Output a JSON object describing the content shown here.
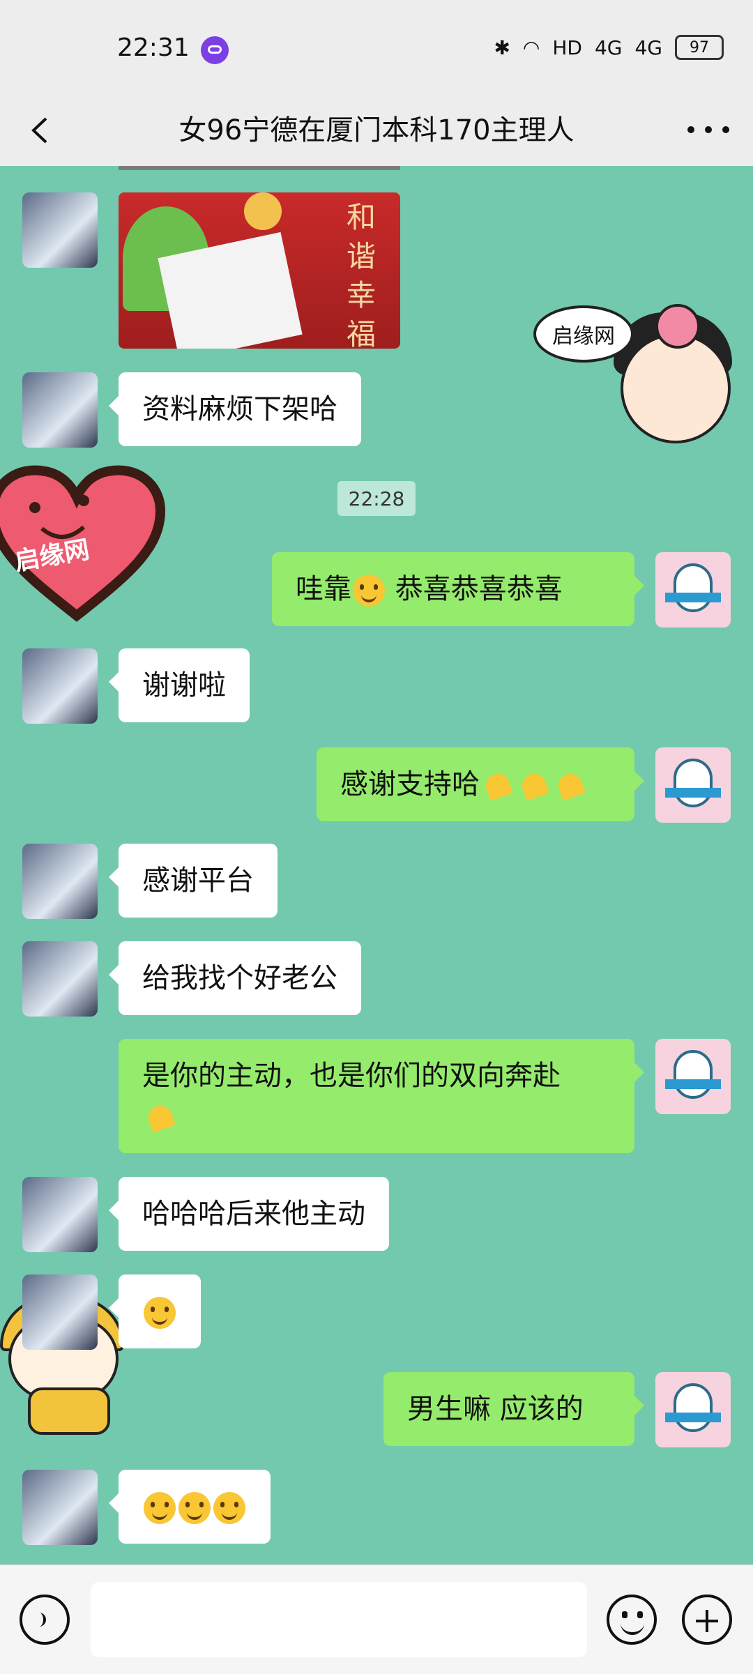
{
  "status": {
    "time": "22:31",
    "battery": "97",
    "network_a": "4G",
    "network_b": "4G",
    "hd": "HD"
  },
  "header": {
    "title": "女96宁德在厦门本科170主理人"
  },
  "chat": {
    "timestamp": "22:28",
    "sticker_girl_text": "启缘网",
    "heart_text": "启缘网",
    "photo_chars": "和谐幸福",
    "messages": [
      {
        "side": "left",
        "text": "资料麻烦下架哈"
      },
      {
        "side": "right",
        "text": "哇靠",
        "text2": "恭喜恭喜恭喜",
        "emoji": "666-emoji"
      },
      {
        "side": "left",
        "text": "谢谢啦"
      },
      {
        "side": "right",
        "text": "感谢支持哈",
        "emoji": "pray-hands-emoji"
      },
      {
        "side": "left",
        "text": "感谢平台"
      },
      {
        "side": "left",
        "text": "给我找个好老公"
      },
      {
        "side": "right",
        "text": "是你的主动，也是你们的双向奔赴",
        "emoji": "handshake-emoji"
      },
      {
        "side": "left",
        "text": "哈哈哈后来他主动"
      },
      {
        "side": "left",
        "emoji": "tears-of-joy-emoji"
      },
      {
        "side": "right",
        "text": "男生嘛  应该的"
      },
      {
        "side": "left",
        "emoji": "grin-emoji"
      }
    ]
  },
  "input_bar": {
    "voice_icon": "voice-icon",
    "emoji_icon": "emoji-icon",
    "plus_icon": "plus-icon"
  }
}
